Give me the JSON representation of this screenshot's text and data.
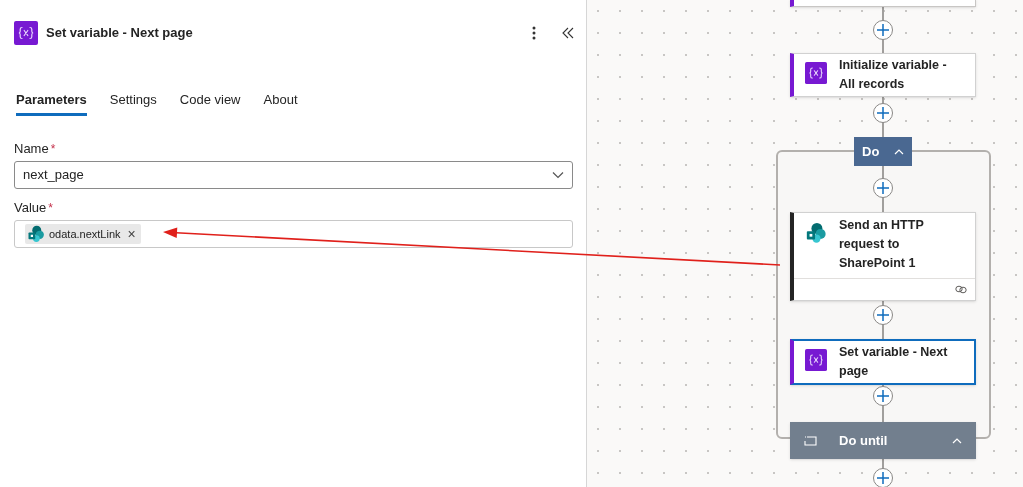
{
  "panel": {
    "title": "Set variable - Next page",
    "tabs": [
      {
        "label": "Parameters",
        "selected": true
      },
      {
        "label": "Settings",
        "selected": false
      },
      {
        "label": "Code view",
        "selected": false
      },
      {
        "label": "About",
        "selected": false
      }
    ],
    "fields": [
      {
        "kind": "dropdown",
        "label": "Name",
        "required": "*",
        "value": "next_page"
      },
      {
        "kind": "tokens",
        "label": "Value",
        "required": "*",
        "tokens": [
          {
            "label": "odata.nextLink",
            "remove": "×"
          }
        ]
      }
    ]
  },
  "canvas": {
    "nodes": [
      {
        "kind": "variable",
        "title": "Initialize variable - All records",
        "selected": false
      },
      {
        "kind": "scope",
        "title": "Do",
        "expanded": true
      },
      {
        "kind": "sharepoint",
        "title": "Send an HTTP request to SharePoint 1",
        "selected": false
      },
      {
        "kind": "variable",
        "title": "Set variable - Next page",
        "selected": true
      },
      {
        "kind": "loop",
        "title": "Do until",
        "expanded": true
      }
    ]
  }
}
